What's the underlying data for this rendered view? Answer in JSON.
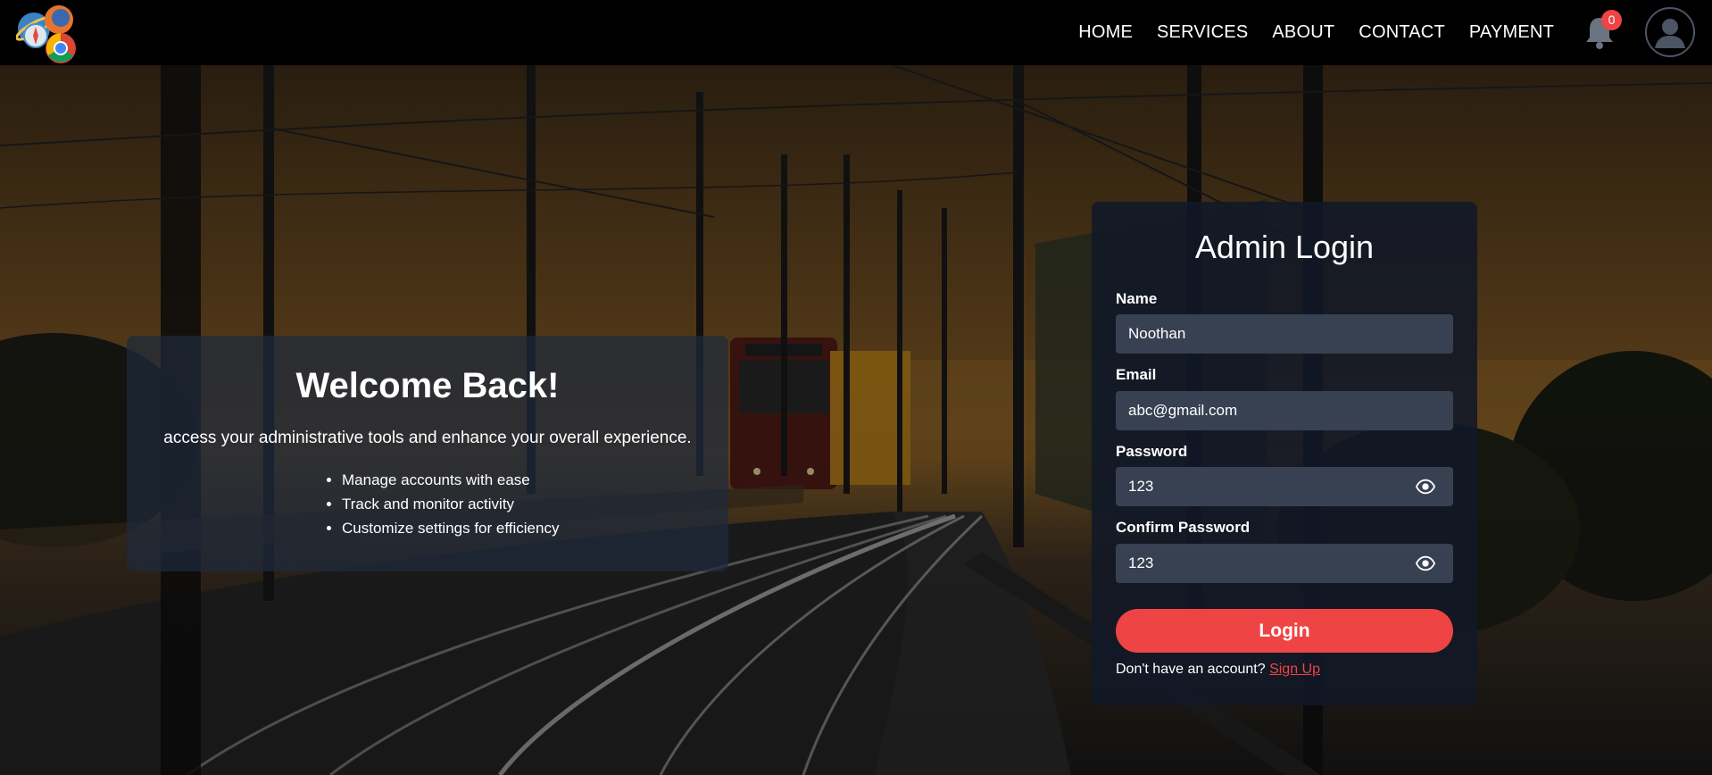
{
  "nav": {
    "items": [
      "HOME",
      "SERVICES",
      "ABOUT",
      "CONTACT",
      "PAYMENT"
    ],
    "notification_count": "0"
  },
  "welcome": {
    "title": "Welcome Back!",
    "subtitle": "access your administrative tools and enhance your overall experience.",
    "features": [
      "Manage accounts with ease",
      "Track and monitor activity",
      "Customize settings for efficiency"
    ]
  },
  "login": {
    "title": "Admin Login",
    "name_label": "Name",
    "name_value": "Noothan",
    "email_label": "Email",
    "email_value": "abc@gmail.com",
    "password_label": "Password",
    "password_value": "123",
    "confirm_label": "Confirm Password",
    "confirm_value": "123",
    "button_label": "Login",
    "no_account_text": "Don't have an account?",
    "signup_link": "Sign Up"
  },
  "colors": {
    "accent": "#ef4444",
    "card": "#111827",
    "input": "#374151",
    "header": "#000000"
  },
  "icons": [
    "browser-logo-icon",
    "bell-icon",
    "user-avatar-icon",
    "eye-icon"
  ]
}
